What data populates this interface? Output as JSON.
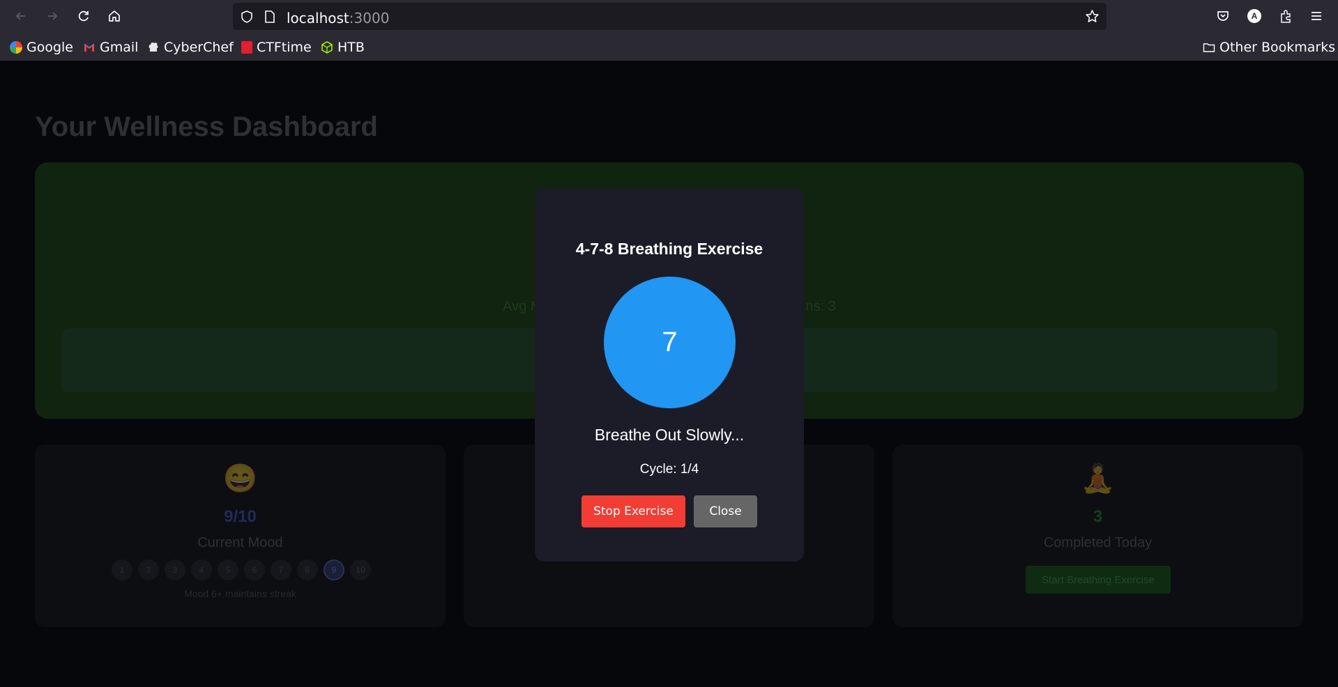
{
  "browser": {
    "url_host": "localhost",
    "url_port": ":3000",
    "bookmarks": [
      {
        "label": "Google",
        "icon": "google-icon"
      },
      {
        "label": "Gmail",
        "icon": "gmail-icon"
      },
      {
        "label": "CyberChef",
        "icon": "cyberchef-icon"
      },
      {
        "label": "CTFtime",
        "icon": "ctftime-icon"
      },
      {
        "label": "HTB",
        "icon": "htb-icon"
      }
    ],
    "other_bookmarks": "Other Bookmarks",
    "profile_initial": "A"
  },
  "dashboard": {
    "title": "Your Wellness Dashboard",
    "hero_stats": "Avg M                                                                    ns: 3",
    "mood_card": {
      "emoji": "😄",
      "value": "9/10",
      "label": "Current Mood",
      "scale": [
        "1",
        "2",
        "3",
        "4",
        "5",
        "6",
        "7",
        "8",
        "9",
        "10"
      ],
      "selected": 9,
      "note": "Mood 6+ maintains streak"
    },
    "breathing_card": {
      "emoji": "🧘",
      "value": "3",
      "label": "Completed Today",
      "button": "Start Breathing Exercise"
    }
  },
  "modal": {
    "title": "4-7-8 Breathing Exercise",
    "count": "7",
    "phase": "Breathe Out Slowly...",
    "cycle": "Cycle: 1/4",
    "stop_label": "Stop Exercise",
    "close_label": "Close"
  },
  "colors": {
    "accent_blue": "#2196f3",
    "stop_red": "#f23d35",
    "close_gray": "#666666"
  }
}
